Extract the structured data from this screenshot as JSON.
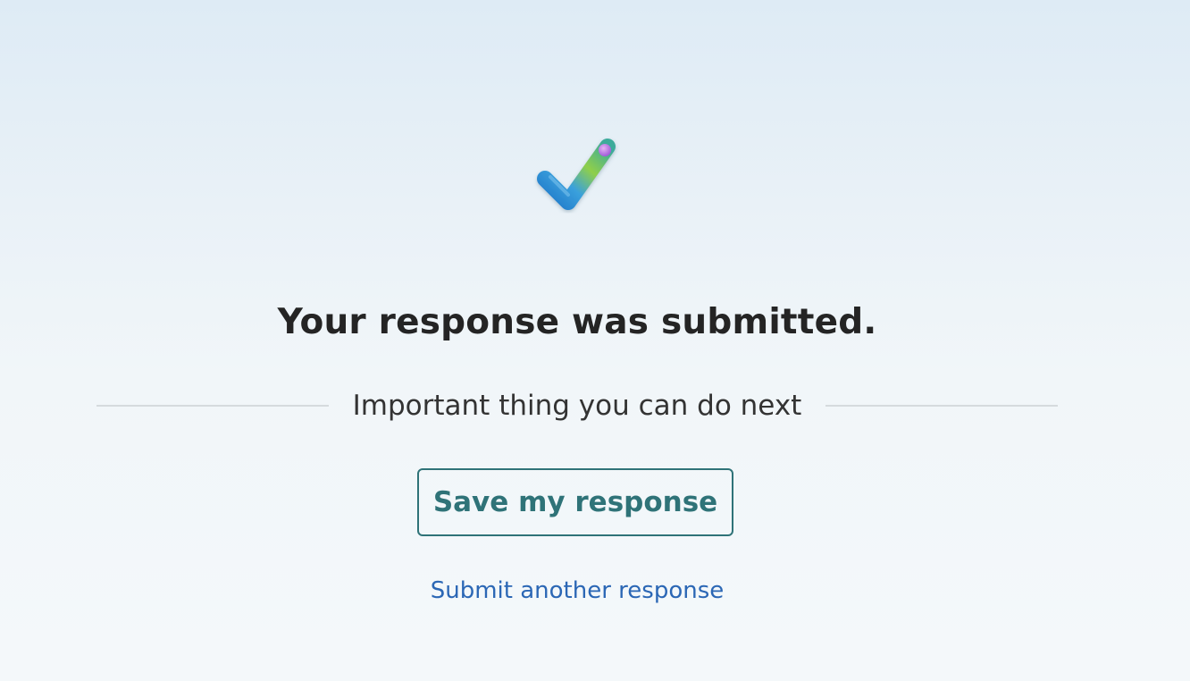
{
  "confirmation": {
    "icon": "check-icon",
    "title": "Your response was submitted.",
    "next_steps_heading": "Important thing you can do next",
    "save_button_label": "Save my response",
    "submit_another_label": "Submit another response"
  },
  "colors": {
    "title": "#242424",
    "accent_teal": "#2f7378",
    "link_blue": "#2b67b5",
    "divider": "#d5dadd"
  }
}
